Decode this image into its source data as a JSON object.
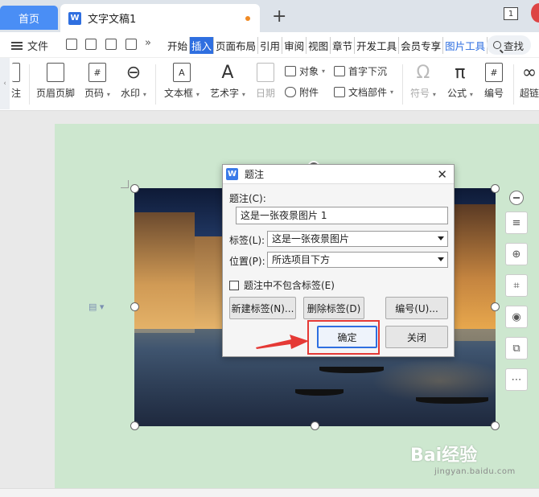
{
  "titlebar": {
    "home_tab": "首页",
    "doc_tab_title": "文字文稿1",
    "add_tab": "+",
    "window_count": "1"
  },
  "menubar": {
    "file_label": "文件",
    "more": "»",
    "tabs": [
      "开始",
      "插入",
      "页面布局",
      "引用",
      "审阅",
      "视图",
      "章节",
      "开发工具",
      "会员专享",
      "图片工具"
    ],
    "active_tab": "插入",
    "search_label": "查找"
  },
  "ribbon": {
    "partial_left": "注",
    "items": [
      {
        "label": "页眉页脚"
      },
      {
        "label": "页码"
      },
      {
        "label": "水印"
      },
      {
        "label": "文本框"
      },
      {
        "label": "艺术字"
      },
      {
        "label": "日期"
      },
      {
        "label": "符号"
      },
      {
        "label": "公式"
      },
      {
        "label": "编号"
      },
      {
        "label": "超链"
      }
    ],
    "small_items": {
      "object": "对象",
      "attachment": "附件",
      "dropcap": "首字下沉",
      "doc_parts": "文档部件"
    }
  },
  "dialog": {
    "title": "题注",
    "caption_label": "题注(C):",
    "caption_value": "这是一张夜景图片 1",
    "tag_label": "标签(L):",
    "tag_value": "这是一张夜景图片",
    "position_label": "位置(P):",
    "position_value": "所选项目下方",
    "exclude_label": "题注中不包含标签(E)",
    "new_tag_btn": "新建标签(N)...",
    "delete_tag_btn": "删除标签(D)",
    "numbering_btn": "编号(U)...",
    "ok_btn": "确定",
    "close_btn": "关闭"
  },
  "watermark": {
    "brand": "Bai经验",
    "sub": "jingyan.baidu.com"
  },
  "colors": {
    "accent": "#2f6fe0",
    "page_bg": "#cde7cf",
    "highlight": "#e53935"
  }
}
